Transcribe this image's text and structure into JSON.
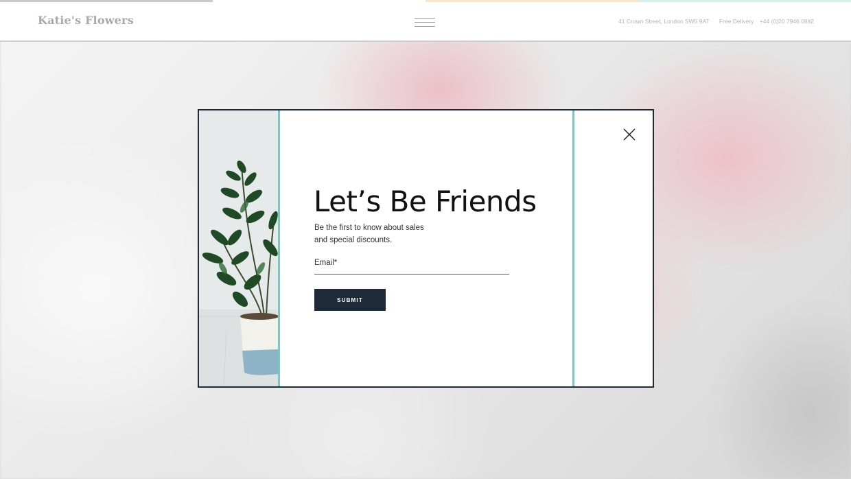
{
  "header": {
    "logo": "Katie's Flowers",
    "address": "41 Crown Street, London SW5 9AT",
    "delivery": "Free Delivery",
    "phone": "+44 (0)20 7946 0882",
    "menu_icon": "hamburger-menu-icon",
    "strip_colors": [
      "#c8c8c8",
      "#ffffff",
      "#f6e7cf",
      "#d7efe9"
    ]
  },
  "modal": {
    "heading": "Let’s Be Friends",
    "subtext_line1": "Be the first to know about sales",
    "subtext_line2": "and special discounts.",
    "email_label": "Email*",
    "submit_label": "SUBMIT",
    "close_icon": "close-icon",
    "image": "potted-plant-image",
    "colors": {
      "border": "#1f2a38",
      "accent": "#7cc7c0",
      "button": "#1f2a38"
    }
  }
}
